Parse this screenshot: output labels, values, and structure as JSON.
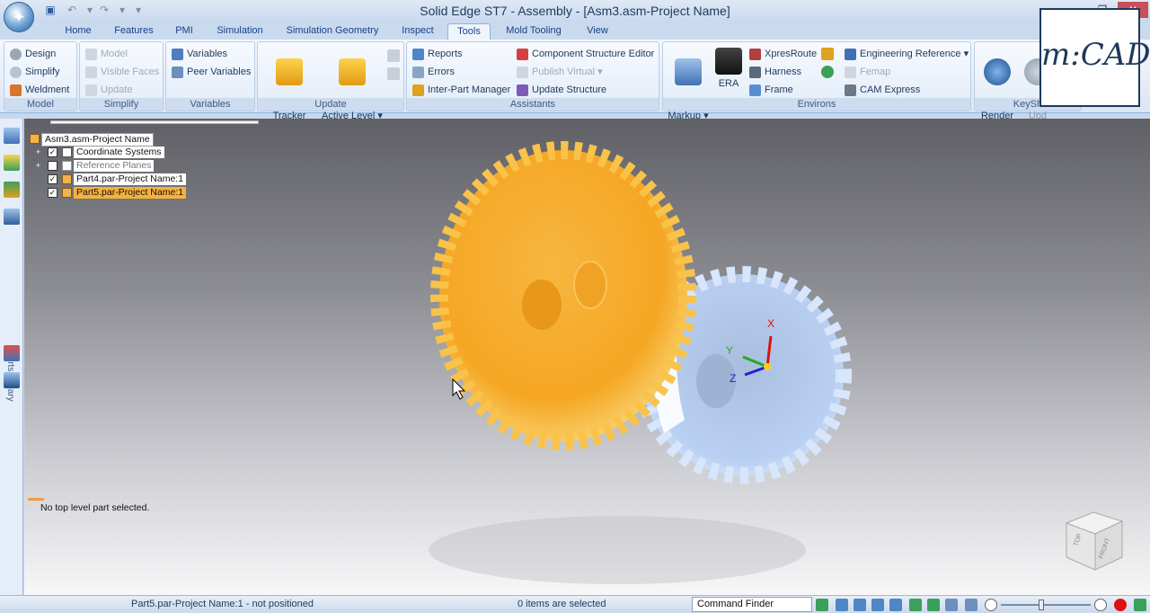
{
  "window": {
    "title": "Solid Edge ST7 - Assembly - [Asm3.asm-Project Name]",
    "minimize": "‒",
    "restore": "❐",
    "close": "✕"
  },
  "tabs": [
    "Home",
    "Features",
    "PMI",
    "Simulation",
    "Simulation Geometry",
    "Inspect",
    "Tools",
    "Mold Tooling",
    "View"
  ],
  "active_tab": "Tools",
  "ribbon": {
    "model_group": {
      "label": "Model",
      "items": [
        "Design",
        "Simplify",
        "Weldment"
      ]
    },
    "simplify_group": {
      "label": "Simplify",
      "items": [
        "Model",
        "Visible Faces",
        "Update"
      ]
    },
    "variables_group": {
      "label": "Variables",
      "items": [
        "Variables",
        "Peer Variables"
      ]
    },
    "update_group": {
      "label": "Update",
      "component_tracker": "Component\nTracker",
      "update_active_level": "Update\nActive Level ▾"
    },
    "assistants_group": {
      "label": "Assistants",
      "items": [
        "Reports",
        "Errors",
        "Inter-Part Manager",
        "Component Structure Editor",
        "Publish Virtual ▾",
        "Update Structure"
      ]
    },
    "environs_group": {
      "label": "Environs",
      "view_markup": "View and\nMarkup ▾",
      "era": "ERA",
      "items": [
        "XpresRoute",
        "Harness",
        "Frame",
        "Engineering Reference ▾",
        "Femap",
        "CAM Express"
      ]
    },
    "keyshot_group": {
      "label": "KeySh",
      "render": "KeyShot\nRender",
      "update": "KeySh\nUpd"
    }
  },
  "left_toolbar": {
    "parts_library": "Parts Library"
  },
  "tree": {
    "root": "Asm3.asm-Project Name",
    "items": [
      {
        "label": "Coordinate Systems",
        "checked": true,
        "expandable": true
      },
      {
        "label": "Reference Planes",
        "checked": false,
        "expandable": true
      },
      {
        "label": "Part4.par-Project Name:1",
        "checked": true,
        "expandable": false
      },
      {
        "label": "Part5.par-Project Name:1",
        "checked": true,
        "expandable": false,
        "selected": true
      }
    ]
  },
  "viewport": {
    "message": "No top level part selected.",
    "axis_labels": {
      "x": "X",
      "y": "Y",
      "z": "Z"
    },
    "view_cube": {
      "top": "TOP",
      "front": "FRONT"
    }
  },
  "watermark": "m:CAD",
  "status": {
    "left": "Part5.par-Project Name:1 - not positioned",
    "center": "0 items are selected",
    "command_finder": "Command Finder"
  },
  "colors": {
    "gear_large": "#f5a623",
    "gear_small": "#a9c4ef",
    "selection": "#f6b13c",
    "accent": "#15428b"
  }
}
